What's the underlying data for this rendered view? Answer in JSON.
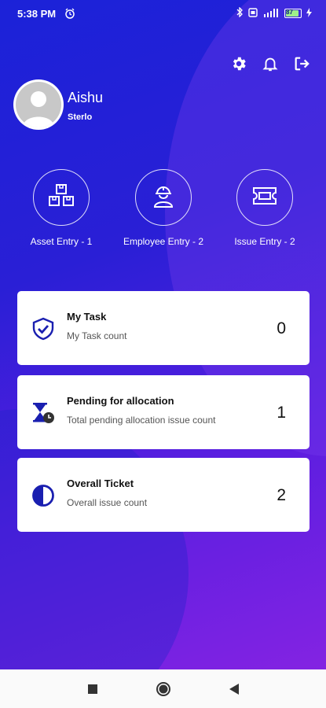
{
  "status_bar": {
    "time": "5:38 PM",
    "battery": "87"
  },
  "header": {
    "icons": [
      "gear-icon",
      "bell-icon",
      "logout-icon"
    ]
  },
  "user": {
    "name": "Aishu",
    "company": "Sterlo"
  },
  "quick_actions": [
    {
      "label": "Asset Entry - 1",
      "icon": "boxes-icon"
    },
    {
      "label": "Employee Entry - 2",
      "icon": "worker-icon"
    },
    {
      "label": "Issue Entry - 2",
      "icon": "ticket-icon"
    }
  ],
  "cards": [
    {
      "title": "My Task",
      "subtitle": "My Task count",
      "count": "0",
      "icon": "shield-check-icon"
    },
    {
      "title": "Pending for allocation",
      "subtitle": "Total pending allocation issue count",
      "count": "1",
      "icon": "hourglass-clock-icon"
    },
    {
      "title": "Overall Ticket",
      "subtitle": "Overall issue count",
      "count": "2",
      "icon": "half-circle-icon"
    }
  ],
  "colors": {
    "accent": "#1a1fb0",
    "gradient_start": "#1b22d8",
    "gradient_end": "#8a24e3"
  }
}
